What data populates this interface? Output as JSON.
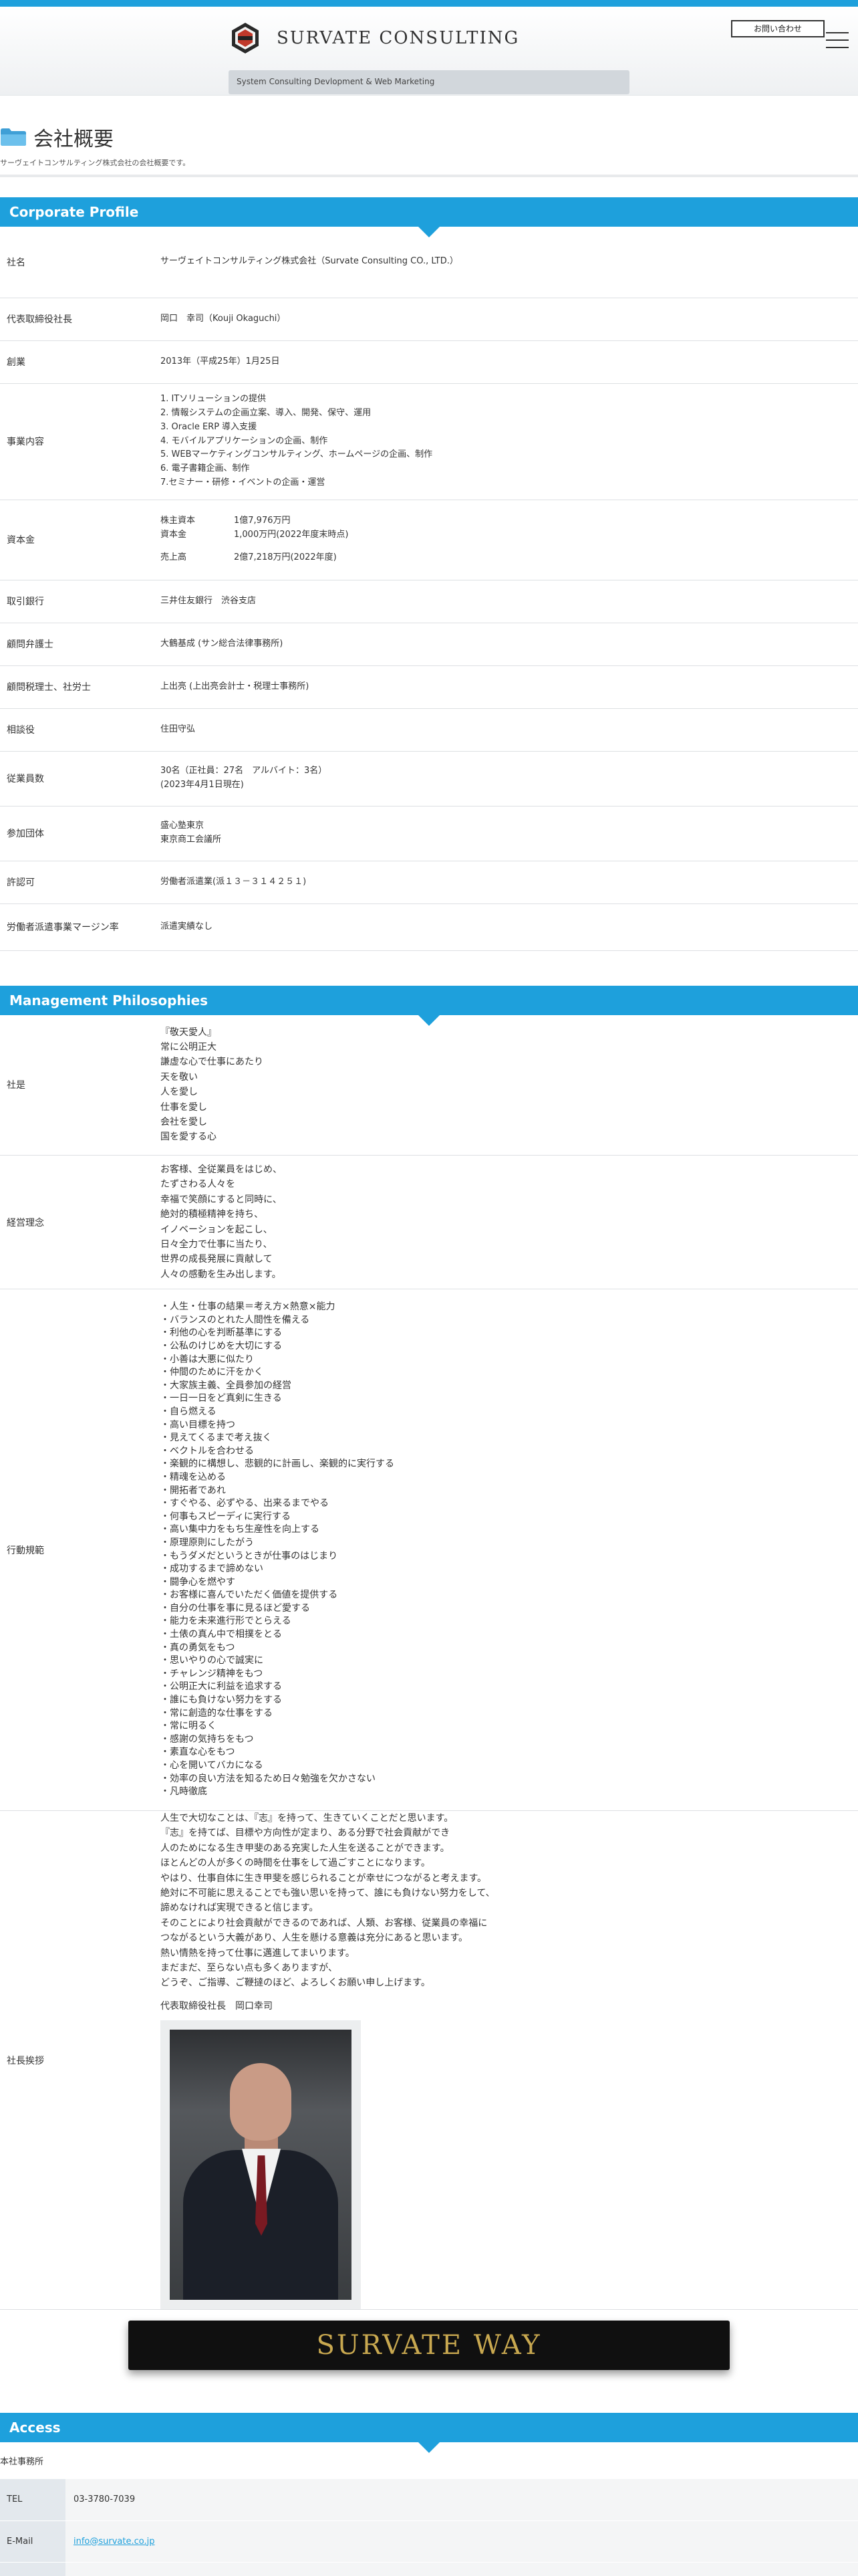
{
  "header": {
    "brand": "SURVATE CONSULTING",
    "tagline": "System Consulting Devlopment & Web Marketing",
    "contact_button": "お問い合わせ"
  },
  "page": {
    "title": "会社概要",
    "subtitle": "サーヴェイトコンサルティング株式会社の会社概要です。"
  },
  "profile": {
    "heading": "Corporate Profile",
    "rows": [
      {
        "label": "社名",
        "value": "サーヴェイトコンサルティング株式会社（Survate Consulting CO., LTD.）"
      },
      {
        "label": "代表取締役社長",
        "value": "岡口　幸司（Kouji Okaguchi）"
      },
      {
        "label": "創業",
        "value": "2013年（平成25年）1月25日"
      },
      {
        "label": "事業内容",
        "items": [
          "1. ITソリューションの提供",
          "2. 情報システムの企画立案、導入、開発、保守、運用",
          "3. Oracle ERP 導入支援",
          "4. モバイルアプリケーションの企画、制作",
          "5. WEBマーケティングコンサルティング、ホームページの企画、制作",
          "6. 電子書籍企画、制作",
          "7.セミナー・研修・イベントの企画・運営"
        ]
      },
      {
        "label": "資本金",
        "lines": [
          {
            "k": "株主資本",
            "v": "1億7,976万円"
          },
          {
            "k": "資本金",
            "v": "1,000万円(2022年度末時点)"
          },
          {
            "k": "売上高",
            "v": "2億7,218万円(2022年度)"
          }
        ]
      },
      {
        "label": "取引銀行",
        "value": "三井住友銀行　渋谷支店"
      },
      {
        "label": "顧問弁護士",
        "value": "大鶴基成 (サン総合法律事務所)"
      },
      {
        "label": "顧問税理士、社労士",
        "value": "上出亮 (上出亮会計士・税理士事務所)"
      },
      {
        "label": "相談役",
        "value": "住田守弘"
      },
      {
        "label": "従業員数",
        "value": "30名（正社員：27名　アルバイト：3名）",
        "value2": "(2023年4月1日現在)"
      },
      {
        "label": "参加団体",
        "value": "盛心塾東京",
        "value2": "東京商工会議所"
      },
      {
        "label": "許認可",
        "value": "労働者派遣業(派１３－３１４２５１)"
      },
      {
        "label": "労働者派遣事業マージン率",
        "value": "派遣実績なし"
      }
    ]
  },
  "philosophy": {
    "heading": "Management Philosophies",
    "shaze": {
      "label": "社是",
      "lines": [
        "『敬天愛人』",
        "常に公明正大",
        "謙虚な心で仕事にあたり",
        "天を敬い",
        "人を愛し",
        "仕事を愛し",
        "会社を愛し",
        "国を愛する心"
      ]
    },
    "rinen": {
      "label": "経営理念",
      "lines": [
        "お客様、全従業員をはじめ、",
        "たずさわる人々を",
        "幸福で笑顔にすると同時に、",
        "絶対的積極精神を持ち、",
        "イノベーションを起こし、",
        "日々全力で仕事に当たり、",
        "世界の成長発展に貢献して",
        "人々の感動を生み出します。"
      ]
    },
    "kihan": {
      "label": "行動規範",
      "lines": [
        "・人生・仕事の結果＝考え方×熱意×能力",
        "・バランスのとれた人間性を備える",
        "・利他の心を判断基準にする",
        "・公私のけじめを大切にする",
        "・小善は大悪に似たり",
        "・仲間のために汗をかく",
        "・大家族主義、全員参加の経営",
        "・一日一日をど真剣に生きる",
        "・自ら燃える",
        "・高い目標を持つ",
        "・見えてくるまで考え抜く",
        "・ベクトルを合わせる",
        "・楽観的に構想し、悲観的に計画し、楽観的に実行する",
        "・精魂を込める",
        "・開拓者であれ",
        "・すぐやる、必ずやる、出来るまでやる",
        "・何事もスピーディに実行する",
        "・高い集中力をもち生産性を向上する",
        "・原理原則にしたがう",
        "・もうダメだというときが仕事のはじまり",
        "・成功するまで諦めない",
        "・闘争心を燃やす",
        "・お客様に喜んでいただく価値を提供する",
        "・自分の仕事を事に見るほど愛する",
        "・能力を未来進行形でとらえる",
        "・土俵の真ん中で相撲をとる",
        "・真の勇気をもつ",
        "・思いやりの心で誠実に",
        "・チャレンジ精神をもつ",
        "・公明正大に利益を追求する",
        "・誰にも負けない努力をする",
        "・常に創造的な仕事をする",
        "・常に明るく",
        "・感謝の気持ちをもつ",
        "・素直な心をもつ",
        "・心を開いてバカになる",
        "・効率の良い方法を知るため日々勉強を欠かさない",
        "・凡時徹底"
      ]
    },
    "greeting": {
      "label": "社長挨拶",
      "lines": [
        "人生で大切なことは、『志』を持って、生きていくことだと思います。",
        "『志』を持てば、目標や方向性が定まり、ある分野で社会貢献ができ",
        "人のためになる生き甲斐のある充実した人生を送ることができます。",
        "ほとんどの人が多くの時間を仕事をして過ごすことになります。",
        "やはり、仕事自体に生き甲斐を感じられることが幸せにつながると考えます。",
        "絶対に不可能に思えることでも強い思いを持って、誰にも負けない努力をして、",
        "諦めなければ実現できると信じます。",
        "そのことにより社会貢献ができるのであれば、人類、お客様、従業員の幸福に",
        "つながるという大義があり、人生を懸ける意義は充分にあると思います。",
        "熱い情熱を持って仕事に邁進してまいります。",
        "まだまだ、至らない点も多くありますが、",
        "どうぞ、ご指導、ご鞭撻のほど、よろしくお願い申し上げます。"
      ],
      "signature": "代表取締役社長　岡口幸司"
    }
  },
  "banner": {
    "text": "SURVATE WAY"
  },
  "access": {
    "heading": "Access",
    "office": "本社事務所",
    "rows": [
      {
        "label": "TEL",
        "value": "03-3780-7039"
      },
      {
        "label": "E-Mail",
        "value": "info@survate.co.jp"
      }
    ]
  }
}
